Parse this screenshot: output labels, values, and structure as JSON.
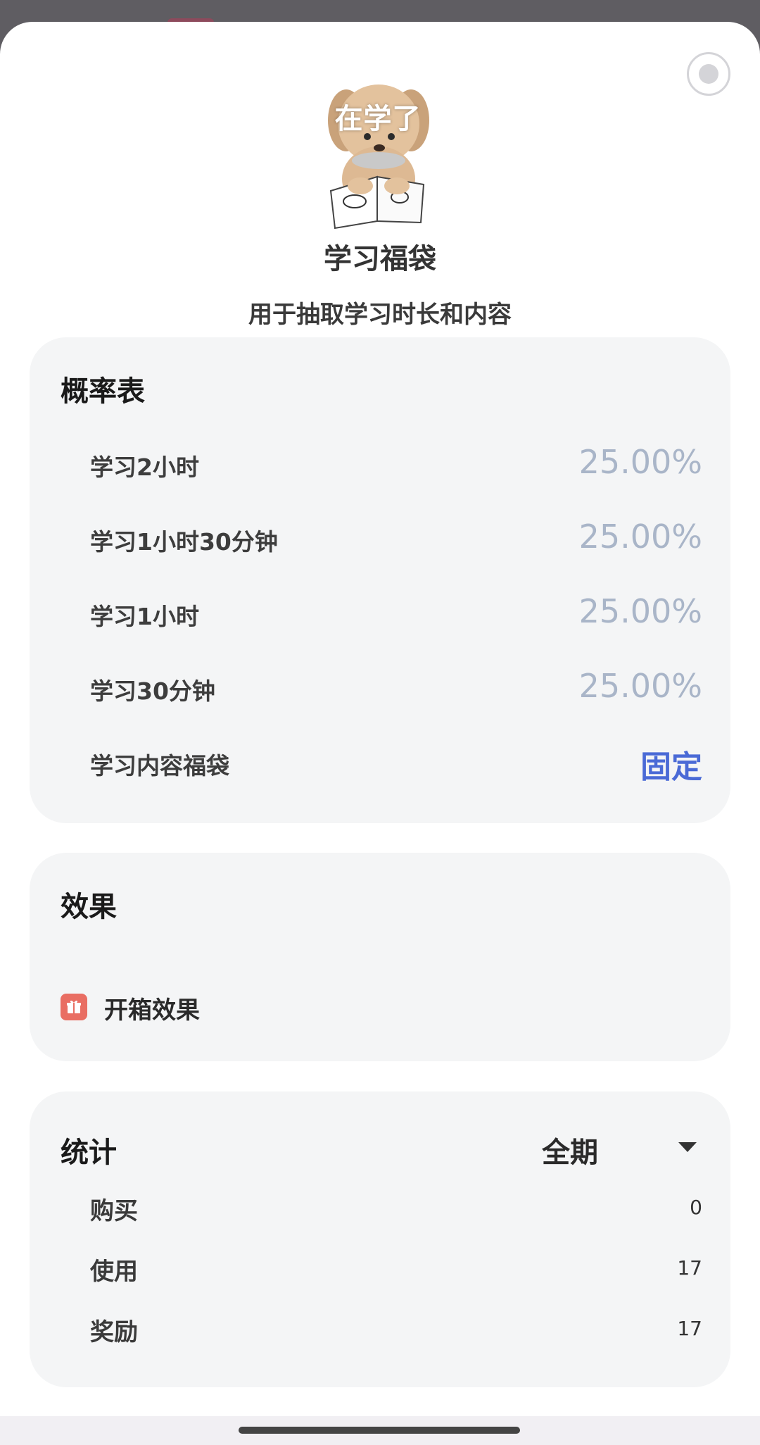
{
  "header": {
    "mascot_caption": "在学了",
    "title": "学习福袋",
    "subtitle": "用于抽取学习时长和内容"
  },
  "probability_table": {
    "title": "概率表",
    "rows": [
      {
        "label": "学习2小时",
        "value": "25.00%"
      },
      {
        "label": "学习1小时30分钟",
        "value": "25.00%"
      },
      {
        "label": "学习1小时",
        "value": "25.00%"
      },
      {
        "label": "学习30分钟",
        "value": "25.00%"
      },
      {
        "label": "学习内容福袋",
        "value": "固定"
      }
    ]
  },
  "effects": {
    "title": "效果",
    "items": [
      {
        "label": "开箱效果",
        "icon": "gift-icon"
      }
    ]
  },
  "stats": {
    "title": "统计",
    "period": "全期",
    "rows": [
      {
        "label": "购买",
        "value": "0"
      },
      {
        "label": "使用",
        "value": "17"
      },
      {
        "label": "奖励",
        "value": "17"
      }
    ]
  },
  "colors": {
    "accent_fixed": "#4a6ad6",
    "percent": "#a9b5c8",
    "gift_icon": "#e96e63"
  }
}
